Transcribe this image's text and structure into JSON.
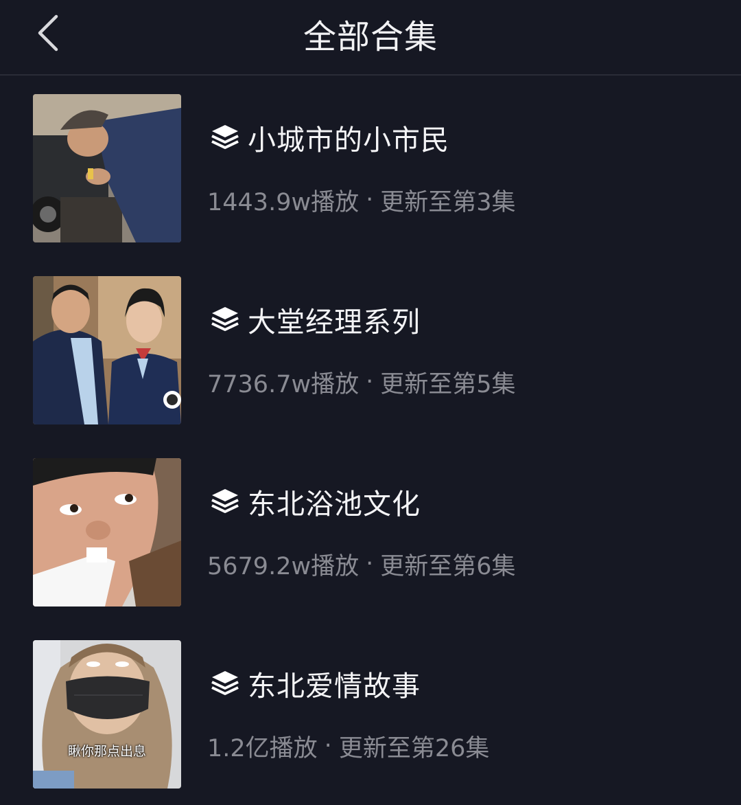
{
  "header": {
    "title": "全部合集",
    "back_icon": "chevron-left-icon"
  },
  "collections": [
    {
      "title": "小城市的小市民",
      "plays": "1443.9w播放",
      "separator": "·",
      "update": "更新至第3集",
      "thumbnail": "man-in-cap-leaning-on-rail"
    },
    {
      "title": "大堂经理系列",
      "plays": "7736.7w播放",
      "separator": "·",
      "update": "更新至第5集",
      "thumbnail": "man-in-suit-and-woman-in-uniform"
    },
    {
      "title": "东北浴池文化",
      "plays": "5679.2w播放",
      "separator": "·",
      "update": "更新至第6集",
      "thumbnail": "man-close-up-face"
    },
    {
      "title": "东北爱情故事",
      "plays": "1.2亿播放",
      "separator": "·",
      "update": "更新至第26集",
      "thumbnail": "woman-with-black-mask",
      "thumbnail_caption": "瞅你那点出息"
    }
  ],
  "colors": {
    "background": "#161823",
    "title_text": "#f4f4f6",
    "meta_text": "#8a8b93",
    "divider": "#2a2c37"
  },
  "icons": {
    "collection": "layers-stack-icon"
  }
}
